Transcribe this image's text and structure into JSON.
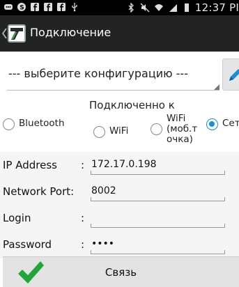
{
  "status_bar": {
    "time": "12:37 PI"
  },
  "action_bar": {
    "title": "Подключение"
  },
  "config": {
    "selected": "--- выберите конфигурацию ---"
  },
  "connection": {
    "label": "Подключенно к",
    "options": [
      {
        "label": "Bluetooth",
        "checked": false
      },
      {
        "label": "WiFi",
        "checked": false
      },
      {
        "label": "WiFi\n(моб.т\nочка)",
        "checked": false
      },
      {
        "label": "Сет",
        "checked": true
      }
    ]
  },
  "form": {
    "ip": {
      "label": "IP Address",
      "colon": ":",
      "value": "172.17.0.198"
    },
    "port": {
      "label": "Network Port:",
      "value": "8002"
    },
    "login": {
      "label": "Login",
      "colon": ":",
      "value": ""
    },
    "password": {
      "label": "Password",
      "colon": ":",
      "value": "••••"
    }
  },
  "connect_button": {
    "label": "Связь"
  },
  "colors": {
    "accent": "#1a8fd6",
    "check": "#22a63a"
  }
}
